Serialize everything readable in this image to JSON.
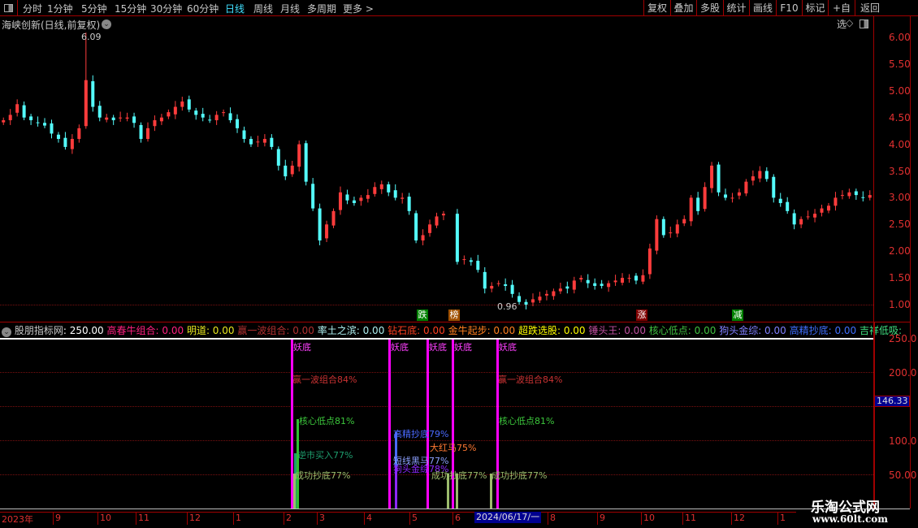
{
  "toolbar": {
    "periods": [
      "分时",
      "1分钟",
      "5分钟",
      "15分钟",
      "30分钟",
      "60分钟",
      "日线",
      "周线",
      "月线",
      "多周期",
      "更多 >"
    ],
    "active_period": "日线",
    "right_buttons": [
      "复权",
      "叠加",
      "多股",
      "统计",
      "画线",
      "F10",
      "标记",
      "+自选",
      "返回"
    ]
  },
  "main_chart": {
    "title": "海峡创新(日线,前复权)",
    "high_label": "6.09",
    "low_label": "0.96",
    "y_ticks": [
      "6.00",
      "5.50",
      "5.00",
      "4.50",
      "4.00",
      "3.50",
      "3.00",
      "2.50",
      "2.00",
      "1.50",
      "1.00"
    ],
    "signals": [
      {
        "text": "跌",
        "color": "#008000"
      },
      {
        "text": "榜",
        "color": "#a05000"
      },
      {
        "text": "涨",
        "color": "#800000"
      },
      {
        "text": "减",
        "color": "#008000"
      }
    ],
    "up_color": "#ff3c3c",
    "down_color": "#54fcfc"
  },
  "chart_data": {
    "type": "candlestick",
    "ylim": [
      0.9,
      6.2
    ],
    "closes": [
      4.45,
      4.55,
      4.75,
      4.5,
      4.45,
      4.4,
      4.35,
      4.2,
      4.1,
      3.95,
      4.1,
      4.3,
      5.2,
      4.7,
      4.5,
      4.5,
      4.45,
      4.5,
      4.5,
      4.4,
      4.1,
      4.3,
      4.45,
      4.5,
      4.6,
      4.7,
      4.8,
      4.65,
      4.55,
      4.5,
      4.45,
      4.55,
      4.6,
      4.45,
      4.3,
      4.1,
      4.0,
      4.05,
      4.1,
      3.95,
      3.6,
      3.4,
      3.6,
      4.0,
      3.3,
      2.8,
      2.2,
      2.5,
      2.75,
      3.1,
      2.95,
      2.9,
      3.0,
      3.05,
      3.2,
      3.25,
      3.1,
      3.0,
      3.0,
      2.75,
      2.2,
      2.3,
      2.5,
      2.65,
      2.7,
      null,
      1.8,
      1.85,
      1.8,
      1.65,
      1.3,
      1.35,
      1.4,
      1.35,
      1.2,
      1.05,
      1.0,
      1.1,
      1.15,
      1.2,
      1.25,
      1.3,
      1.3,
      1.45,
      1.5,
      1.4,
      1.35,
      1.35,
      1.4,
      1.45,
      1.5,
      1.5,
      1.45,
      1.55,
      2.05,
      2.6,
      2.3,
      2.35,
      2.5,
      2.6,
      3.0,
      2.75,
      3.2,
      3.6,
      3.1,
      3.0,
      3.0,
      3.1,
      3.3,
      3.4,
      3.5,
      3.35,
      3.0,
      2.9,
      2.75,
      2.5,
      2.6,
      2.65,
      2.7,
      2.8,
      2.85,
      3.0,
      3.05,
      3.1,
      3.05,
      3.0,
      3.05
    ]
  },
  "indicator": {
    "name": "股朋指标网",
    "value": ": 250.00",
    "legend": [
      {
        "label": "高春牛组合:",
        "value": " 0.00",
        "color": "#ff2080"
      },
      {
        "label": "明道:",
        "value": " 0.00",
        "color": "#e8e820"
      },
      {
        "label": "赢一波组合:",
        "value": " 0.00",
        "color": "#b03030"
      },
      {
        "label": "率土之滨:",
        "value": " 0.00",
        "color": "#b0f0f0"
      },
      {
        "label": "钻石底:",
        "value": " 0.00",
        "color": "#ff4020"
      },
      {
        "label": "金牛起步:",
        "value": " 0.00",
        "color": "#ff8020"
      },
      {
        "label": "超跌选股:",
        "value": " 0.00",
        "color": "#ffff00"
      },
      {
        "label": "锤头王:",
        "value": " 0.00",
        "color": "#c050a0"
      },
      {
        "label": "核心低点:",
        "value": " 0.00",
        "color": "#40c040"
      },
      {
        "label": "狗头金综:",
        "value": " 0.00",
        "color": "#8080ff"
      },
      {
        "label": "高精抄底:",
        "value": " 0.00",
        "color": "#4070ff"
      },
      {
        "label": "吉祥低吸:",
        "value": "",
        "color": "#40e080"
      }
    ],
    "y_ticks": [
      "250.0",
      "200.0",
      "100.0",
      "50.00"
    ],
    "current_value": "146.33",
    "marker_label": "妖底",
    "labels": {
      "yiboprob": "赢一波组合84%",
      "hexin": "核心低点81%",
      "nishi": "逆市买入77%",
      "chenggong": "成功抄底77%",
      "gaojing": "高精抄底79%",
      "dahongma": "大红马75%",
      "duanxian": "短线黑马77%",
      "goutou": "狗头金综78%"
    }
  },
  "x_axis": {
    "labels": [
      "2023年",
      "9",
      "10",
      "11",
      "12",
      "1",
      "2",
      "3",
      "4",
      "5",
      "6",
      "8",
      "9",
      "10",
      "11",
      "12",
      "1"
    ],
    "cursor_date": "2024/06/17/一"
  },
  "watermark": {
    "title": "乐淘公式网",
    "url": "www.60lt.com"
  }
}
